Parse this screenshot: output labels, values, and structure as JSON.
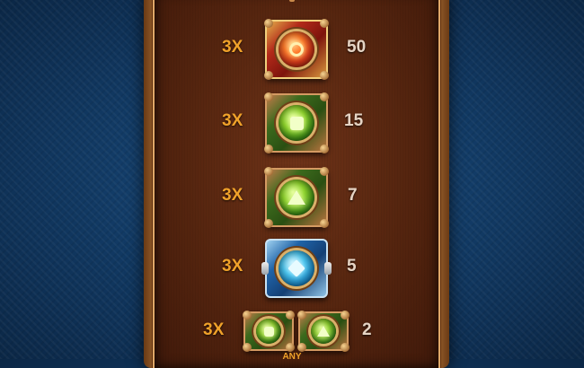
{
  "paytable": {
    "rows": [
      {
        "multiplier": "3X",
        "payout": "50",
        "symbol": "red-ring-gem"
      },
      {
        "multiplier": "3X",
        "payout": "15",
        "symbol": "green-square-gem"
      },
      {
        "multiplier": "3X",
        "payout": "7",
        "symbol": "green-triangle-gem"
      },
      {
        "multiplier": "3X",
        "payout": "5",
        "symbol": "blue-diamond-gem"
      },
      {
        "multiplier": "3X",
        "payout": "2",
        "symbol": "any-green-combo"
      }
    ],
    "any_label": "ANY"
  },
  "colors": {
    "multiplier_text": "#f0a22a",
    "payout_text": "#e6d4c4",
    "background": "#123b66",
    "panel": "#55250f"
  }
}
